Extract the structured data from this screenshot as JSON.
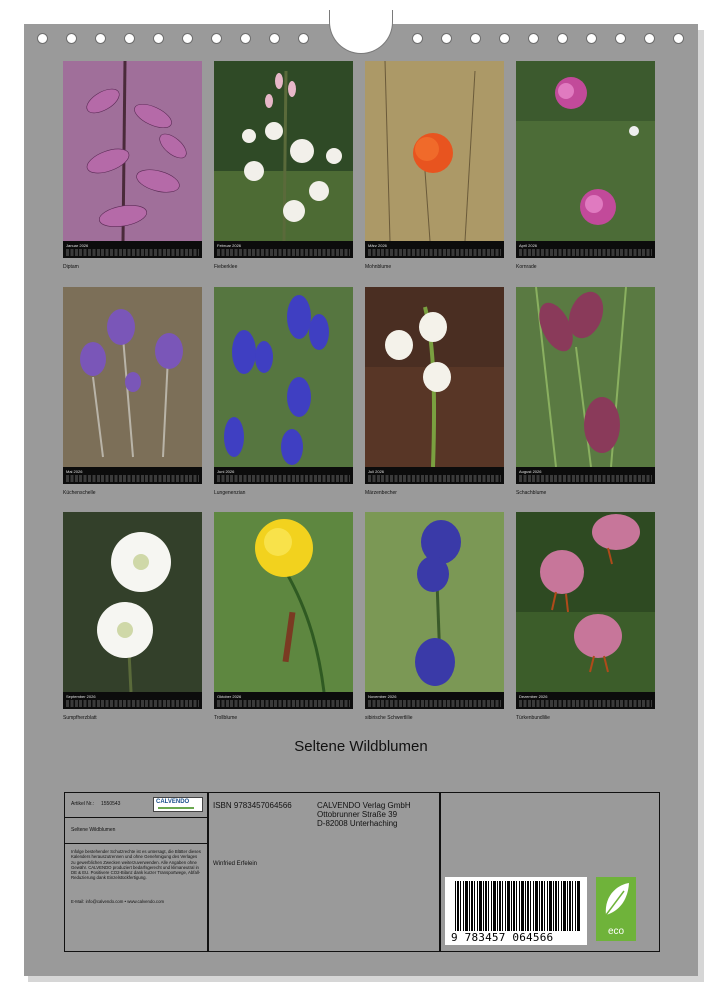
{
  "calendar_title": "Seltene Wildblumen",
  "months": [
    {
      "label": "Januar 2026",
      "flower": "Diptam"
    },
    {
      "label": "Februar 2026",
      "flower": "Fieberklee"
    },
    {
      "label": "März 2026",
      "flower": "Mohnblume"
    },
    {
      "label": "April 2026",
      "flower": "Kornrade"
    },
    {
      "label": "Mai 2026",
      "flower": "Küchenschelle"
    },
    {
      "label": "Juni 2026",
      "flower": "Lungenenzian"
    },
    {
      "label": "Juli 2026",
      "flower": "Märzenbecher"
    },
    {
      "label": "August 2026",
      "flower": "Schachblume"
    },
    {
      "label": "September 2026",
      "flower": "Sumpfherzblatt"
    },
    {
      "label": "Oktober 2026",
      "flower": "Trollblume"
    },
    {
      "label": "November 2026",
      "flower": "sibirische Schwertlilie"
    },
    {
      "label": "Dezember 2026",
      "flower": "Türkenbundlilie"
    }
  ],
  "info": {
    "article_label": "Artikel Nr.:",
    "article_number": "1550543",
    "brand": "CALVENDO",
    "series_title": "Seltene Wildblumen",
    "copyright_text": "Infolge bestehender Schutzrechte ist es untersagt, die Blätter dieses Kalenders herauszutrennen und ohne Genehmigung des Verlages zu gewerblichen Zwecken weiterzuverwenden. Alle Angaben ohne Gewähr. CALVENDO produziert bedarfsgerecht und klimaneutral in DE & EU. Positivere CO2-Bilanz dank kurzer Transportwege, Abfall-Reduzierung dank Einzelstückfertigung.",
    "contact": "E-Mail: info@calvendo.com • www.calvendo.com",
    "isbn": "ISBN 9783457064566",
    "author": "Winfried Erfelein",
    "publisher_name": "CALVENDO Verlag GmbH",
    "publisher_street": "Ottobrunner Straße 39",
    "publisher_city": "D-82008 Unterhaching",
    "barcode_number": "9 783457 064566",
    "eco_label": "eco"
  },
  "colors": {
    "page": "#9a9a9a",
    "strip": "#0c0c0c",
    "eco": "#6fb33a"
  }
}
